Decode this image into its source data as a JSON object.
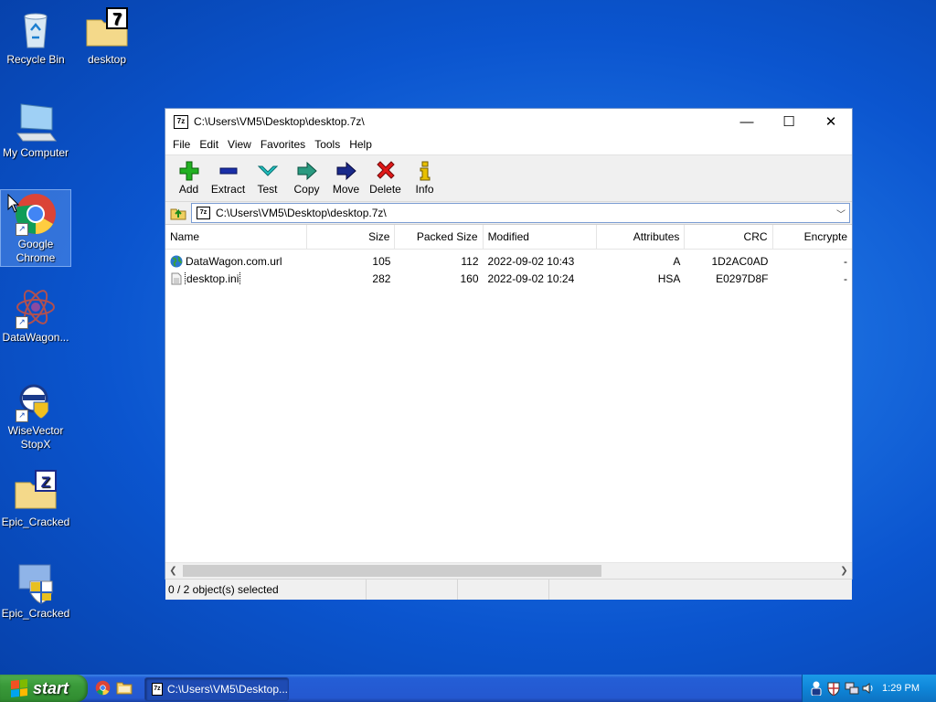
{
  "desktop": {
    "icons": [
      {
        "label": "Recycle Bin"
      },
      {
        "label": "desktop"
      },
      {
        "label": "My Computer"
      },
      {
        "label": "Google Chrome"
      },
      {
        "label": "DataWagon..."
      },
      {
        "label": "WiseVector StopX"
      },
      {
        "label": "Epic_Cracked"
      },
      {
        "label": "Epic_Cracked"
      }
    ]
  },
  "window": {
    "title": "C:\\Users\\VM5\\Desktop\\desktop.7z\\",
    "app_icon_text": "7z",
    "controls": {
      "minimize": "—",
      "maximize": "☐",
      "close": "✕"
    },
    "menu": [
      "File",
      "Edit",
      "View",
      "Favorites",
      "Tools",
      "Help"
    ],
    "toolbar": [
      "Add",
      "Extract",
      "Test",
      "Copy",
      "Move",
      "Delete",
      "Info"
    ],
    "address": "C:\\Users\\VM5\\Desktop\\desktop.7z\\",
    "columns": [
      "Name",
      "Size",
      "Packed Size",
      "Modified",
      "Attributes",
      "CRC",
      "Encrypte"
    ],
    "rows": [
      {
        "name": "DataWagon.com.url",
        "size": "105",
        "packed": "112",
        "modified": "2022-09-02 10:43",
        "attributes": "A",
        "crc": "1D2AC0AD",
        "encrypted": "-",
        "icon": "globe-icon"
      },
      {
        "name": "desktop.ini",
        "size": "282",
        "packed": "160",
        "modified": "2022-09-02 10:24",
        "attributes": "HSA",
        "crc": "E0297D8F",
        "encrypted": "-",
        "icon": "ini-file-icon"
      }
    ],
    "status": "0 / 2 object(s) selected"
  },
  "taskbar": {
    "start_label": "start",
    "task_label": "C:\\Users\\VM5\\Desktop...",
    "task_icon_text": "7z",
    "clock": "1:29 PM"
  },
  "colors": {
    "add": "#18a018",
    "extract": "#1a2fa8",
    "test": "#1fb0b0",
    "copy": "#2a8a78",
    "move": "#1a2a8a",
    "delete": "#d01818",
    "info": "#d8b400"
  }
}
